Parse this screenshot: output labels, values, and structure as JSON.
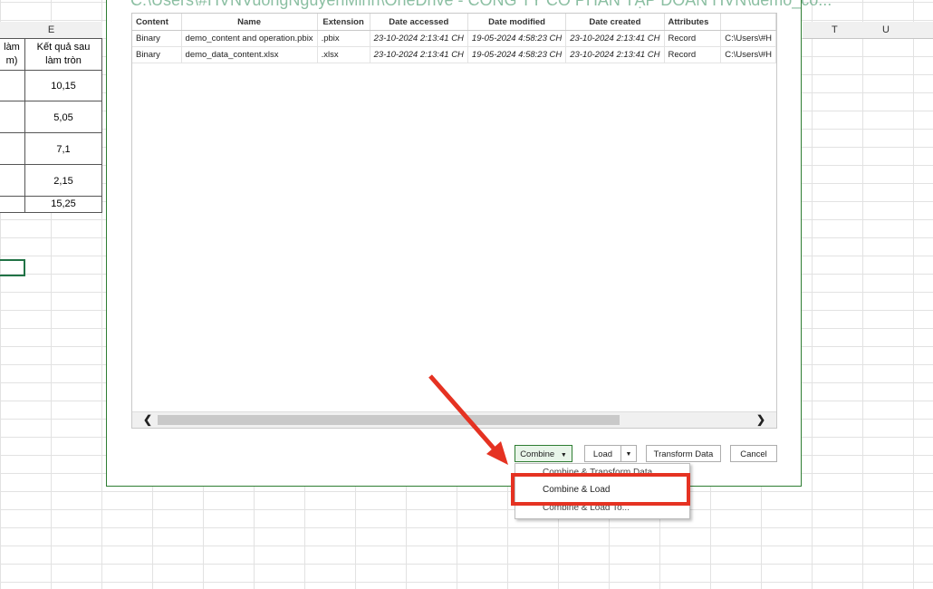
{
  "dialog": {
    "path": "C:\\Users\\#HVNVuongNguyenMinh\\OneDrive - CÔNG TY CỔ PHẦN TẬP ĐOÀN HVN\\demo_co...",
    "columns": [
      "Content",
      "Name",
      "Extension",
      "Date accessed",
      "Date modified",
      "Date created",
      "Attributes",
      ""
    ],
    "rows": [
      [
        "Binary",
        "demo_content and operation.pbix",
        ".pbix",
        "23-10-2024 2:13:41 CH",
        "19-05-2024 4:58:23 CH",
        "23-10-2024 2:13:41 CH",
        "Record",
        "C:\\Users\\#H"
      ],
      [
        "Binary",
        "demo_data_content.xlsx",
        ".xlsx",
        "23-10-2024 2:13:41 CH",
        "19-05-2024 4:58:23 CH",
        "23-10-2024 2:13:41 CH",
        "Record",
        "C:\\Users\\#H"
      ]
    ],
    "buttons": {
      "combine": "Combine",
      "load": "Load",
      "transform": "Transform Data",
      "cancel": "Cancel"
    },
    "menu": [
      "Combine & Transform Data",
      "Combine & Load",
      "Combine & Load To..."
    ]
  },
  "sheet": {
    "col_e": "E",
    "col_t": "T",
    "col_u": "U",
    "header_d": [
      "làm",
      "m)"
    ],
    "header_e": [
      "Kết quả sau",
      "làm tròn"
    ],
    "values": [
      "10,15",
      "5,05",
      "7,1",
      "2,15",
      "15,25"
    ]
  }
}
